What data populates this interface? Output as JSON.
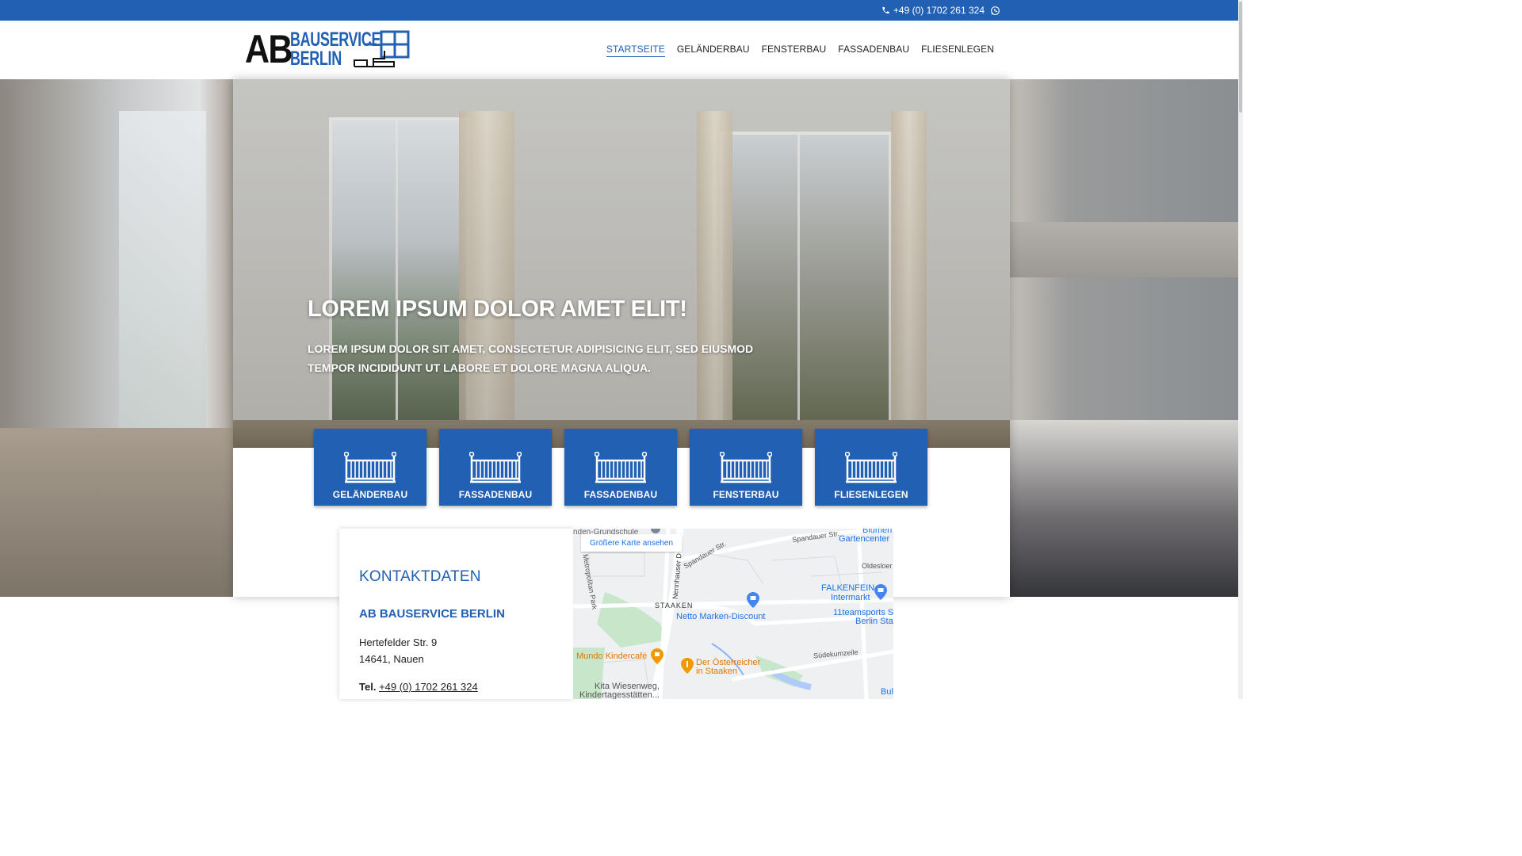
{
  "topbar": {
    "phone": "+49 (0) 1702 261 324",
    "icons": [
      "phone-icon",
      "whatsapp-icon"
    ]
  },
  "logo": {
    "ab": "AB",
    "line1": "BAUSERVICE",
    "line2": "BERLIN"
  },
  "nav": {
    "items": [
      {
        "label": "STARTSEITE",
        "active": true
      },
      {
        "label": "GELÄNDERBAU",
        "active": false
      },
      {
        "label": "FENSTERBAU",
        "active": false
      },
      {
        "label": "FASSADENBAU",
        "active": false
      },
      {
        "label": "FLIESENLEGEN",
        "active": false
      }
    ]
  },
  "hero": {
    "title": "LOREM IPSUM DOLOR AMET ELIT!",
    "subtitle": "LOREM IPSUM DOLOR SIT AMET, CONSECTETUR ADIPISICING ELIT, SED EIUSMOD TEMPOR INCIDIDUNT UT LABORE ET DOLORE MAGNA ALIQUA."
  },
  "services": [
    {
      "label": "GELÄNDERBAU",
      "icon": "railing-icon"
    },
    {
      "label": "FASSADENBAU",
      "icon": "railing-icon"
    },
    {
      "label": "FASSADENBAU",
      "icon": "railing-icon"
    },
    {
      "label": "FENSTERBAU",
      "icon": "railing-icon"
    },
    {
      "label": "FLIESENLEGEN",
      "icon": "railing-icon"
    }
  ],
  "contact": {
    "heading": "KONTAKTDATEN",
    "company": "AB BAUSERVICE BERLIN",
    "street": "Hertefelder Str. 9",
    "city": "14641, Nauen",
    "tel_label": "Tel.",
    "tel": "+49 (0) 1702 261 324"
  },
  "map": {
    "button": "Größere Karte ansehen",
    "labels": {
      "school": "nden-Grundschule",
      "spandauer1": "Spandauer Str.",
      "spandauer2": "Spandauer Str.",
      "blumen1": "Blumen",
      "blumen2": "Gartencenter",
      "oldesloer": "Oldesloer W",
      "falkenfein1": "FALKENFEIN",
      "falkenfein2": "Intermarkt",
      "staaken": "STAAKEN",
      "netto": "Netto Marken-Discount",
      "nennhauser": "Nennhauser D",
      "metropolitan": "Metropolitan Park",
      "teamsports1": "11teamsports S",
      "teamsports2": "Berlin Sta",
      "mundo": "Mundo Kindercafé",
      "oesterreicher1": "Der Österreicher",
      "oesterreicher2": "in Staaken",
      "suedekum": "Südekumzeile",
      "kita1": "Kita Wiesenweg,",
      "kita2": "Kindertagesstätten...",
      "bul": "Bul"
    }
  },
  "colors": {
    "brand": "#2160b3",
    "topbar": "#2160b3"
  }
}
